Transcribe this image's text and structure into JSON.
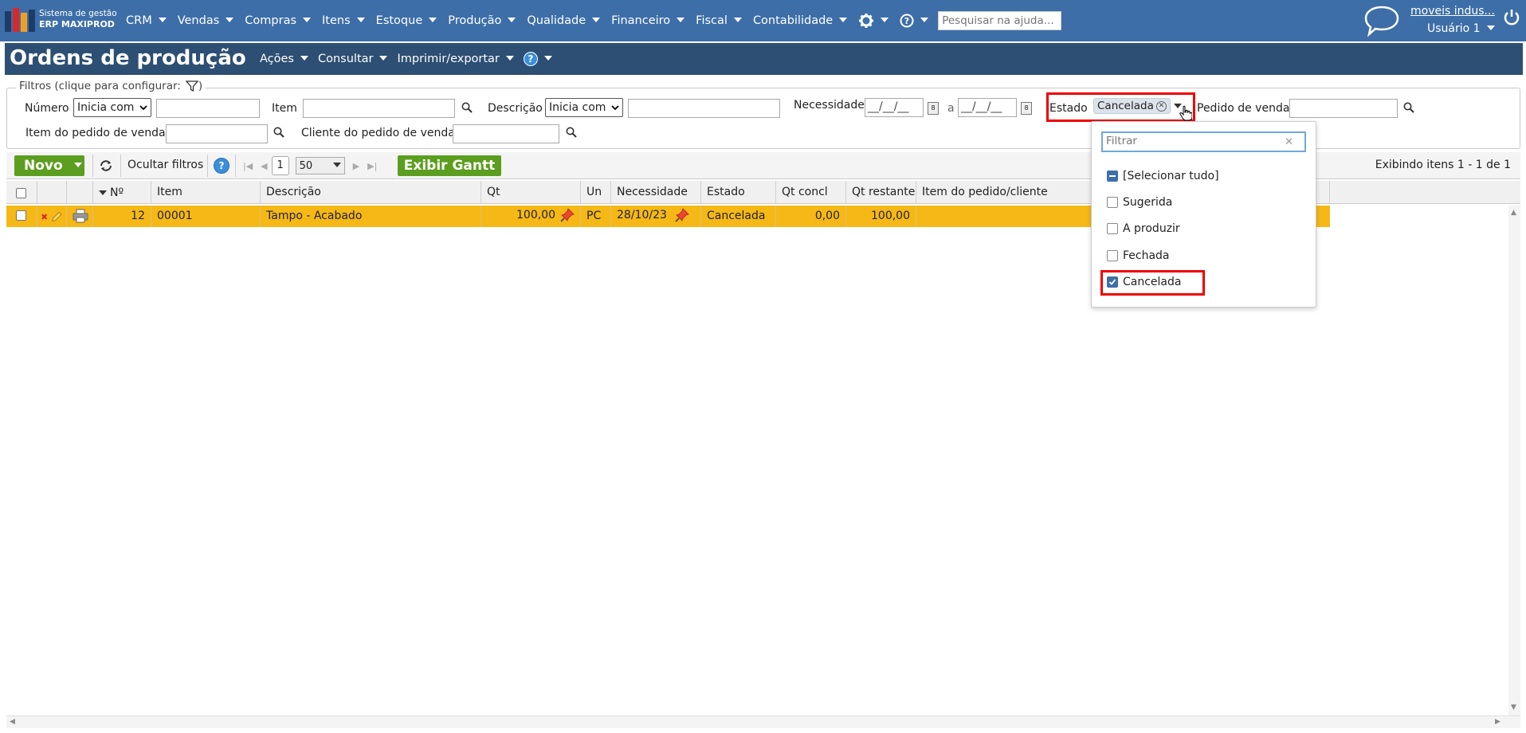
{
  "topbar": {
    "logo_line1": "Sistema de gestão",
    "logo_line2": "ERP MAXIPROD",
    "menu": [
      "CRM",
      "Vendas",
      "Compras",
      "Itens",
      "Estoque",
      "Produção",
      "Qualidade",
      "Financeiro",
      "Fiscal",
      "Contabilidade"
    ],
    "search_placeholder": "Pesquisar na ajuda...",
    "company": "moveis indus...",
    "user": "Usuário 1"
  },
  "titlebar": {
    "title": "Ordens de produção",
    "menu": [
      "Ações",
      "Consultar",
      "Imprimir/exportar"
    ]
  },
  "filters": {
    "legend": "Filtros (clique para configurar:",
    "legend_close": ")",
    "numero_label": "Número",
    "numero_mode": "Inicia com",
    "item_label": "Item",
    "descricao_label": "Descrição",
    "descricao_mode": "Inicia com",
    "necessidade_label": "Necessidade",
    "date_from": "__/__/__",
    "date_sep": "a",
    "date_to": "__/__/__",
    "estado_label": "Estado",
    "estado_chip": "Cancelada",
    "pedido_label": "Pedido de venda",
    "item_pedido_label": "Item do pedido de venda",
    "cliente_pedido_label": "Cliente do pedido de venda"
  },
  "toolbar": {
    "novo": "Novo",
    "ocultar": "Ocultar filtros",
    "page": "1",
    "page_size": "50",
    "gantt": "Exibir Gantt",
    "exibindo": "Exibindo itens 1 - 1 de 1"
  },
  "grid": {
    "headers": [
      "Nº",
      "Item",
      "Descrição",
      "Qt",
      "Un",
      "Necessidade",
      "Estado",
      "Qt concl",
      "Qt restante",
      "Item do pedido/cliente"
    ],
    "rows": [
      {
        "numero": "12",
        "item": "00001",
        "descricao": "Tampo - Acabado",
        "qt": "100,00",
        "un": "PC",
        "necessidade": "28/10/23",
        "estado": "Cancelada",
        "qt_concl": "0,00",
        "qt_restante": "100,00",
        "item_pedido": ""
      }
    ]
  },
  "dropdown": {
    "filter_placeholder": "Filtrar",
    "options": [
      {
        "label": "[Selecionar tudo]",
        "state": "partial"
      },
      {
        "label": "Sugerida",
        "state": "unchecked"
      },
      {
        "label": "A produzir",
        "state": "unchecked"
      },
      {
        "label": "Fechada",
        "state": "unchecked"
      },
      {
        "label": "Cancelada",
        "state": "checked"
      }
    ]
  },
  "colors": {
    "topbar": "#3d6ea8",
    "titlebar": "#2c4f73",
    "row_highlight": "#f5b816",
    "green_button": "#5c9e1f",
    "highlight_box": "#ee0000"
  }
}
